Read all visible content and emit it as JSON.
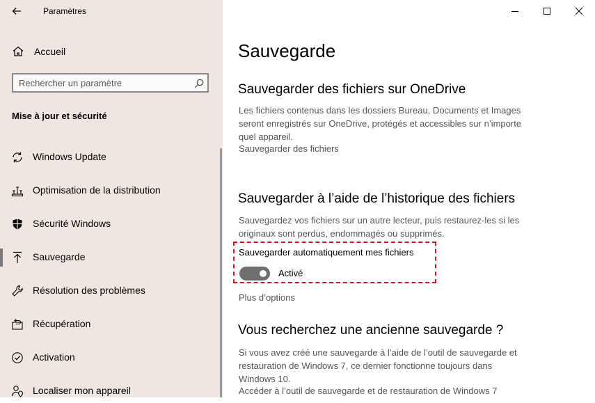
{
  "window": {
    "title": "Paramètres",
    "controls": [
      "minimize-icon",
      "maximize-icon",
      "close-icon"
    ]
  },
  "sidebar": {
    "home_label": "Accueil",
    "search_placeholder": "Rechercher un paramètre",
    "section_title": "Mise à jour et sécurité",
    "items": [
      {
        "label": "Windows Update",
        "icon": "refresh-icon"
      },
      {
        "label": "Optimisation de la distribution",
        "icon": "delivery-optimization-icon"
      },
      {
        "label": "Sécurité Windows",
        "icon": "shield-icon"
      },
      {
        "label": "Sauvegarde",
        "icon": "upload-icon",
        "selected": true
      },
      {
        "label": "Résolution des problèmes",
        "icon": "wrench-icon"
      },
      {
        "label": "Récupération",
        "icon": "recovery-icon"
      },
      {
        "label": "Activation",
        "icon": "activation-icon"
      },
      {
        "label": "Localiser mon appareil",
        "icon": "person-location-icon"
      }
    ]
  },
  "main": {
    "page_title": "Sauvegarde",
    "onedrive": {
      "heading": "Sauvegarder des fichiers sur OneDrive",
      "description_lines": [
        "Les fichiers contenus dans les dossiers Bureau, Documents et Images",
        "seront enregistrés sur OneDrive, protégés et accessibles sur n’importe",
        "quel appareil."
      ],
      "link": "Sauvegarder des fichiers"
    },
    "file_history": {
      "heading": "Sauvegarder à l’aide de l’historique des fichiers",
      "description_lines": [
        "Sauvegardez vos fichiers sur un autre lecteur, puis restaurez-les si les",
        "originaux sont perdus, endommagés ou supprimés."
      ],
      "toggle_label": "Sauvegarder automatiquement mes fichiers",
      "toggle_state": "Activé",
      "toggle_on": true,
      "more_options": "Plus d’options"
    },
    "old_backup": {
      "heading": "Vous recherchez une ancienne sauvegarde ?",
      "description_lines": [
        "Si vous avez créé une sauvegarde à l’aide de l’outil de sauvegarde et",
        "restauration de Windows 7, ce dernier fonctionne toujours dans",
        "Windows 10."
      ],
      "link": "Accéder à l’outil de sauvegarde et de restauration de Windows 7"
    }
  },
  "colors": {
    "sidebar_bg": "#efe6e1",
    "highlight_border": "#e0101a",
    "toggle_bg": "#6e6e6e"
  }
}
